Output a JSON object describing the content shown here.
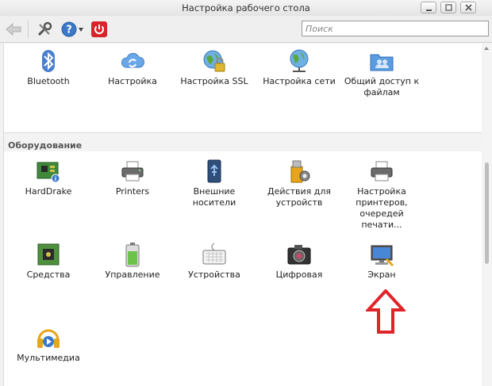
{
  "window": {
    "title": "Настройка рабочего стола"
  },
  "toolbar": {
    "search_placeholder": "Поиск"
  },
  "top_row": [
    {
      "label": "Bluetooth",
      "icon": "bluetooth-icon"
    },
    {
      "label": "Настройка",
      "icon": "cloud-sync-icon"
    },
    {
      "label": "Настройка SSL",
      "icon": "globe-lock-icon"
    },
    {
      "label": "Настройка сети",
      "icon": "globe-network-icon"
    },
    {
      "label": "Общий доступ к файлам",
      "icon": "shared-folder-icon"
    }
  ],
  "hardware": {
    "title": "Оборудование",
    "items": [
      {
        "label": "HardDrake",
        "icon": "circuit-board-icon"
      },
      {
        "label": "Printers",
        "icon": "printer-icon"
      },
      {
        "label": "Внешние носители",
        "icon": "usb-drive-icon"
      },
      {
        "label": "Действия для устройств",
        "icon": "usb-gear-icon"
      },
      {
        "label": "Настройка принтеров, очередей печати...",
        "icon": "printer-queue-icon"
      },
      {
        "label": "Средства",
        "icon": "chip-tools-icon"
      },
      {
        "label": "Управление",
        "icon": "battery-icon"
      },
      {
        "label": "Устройства",
        "icon": "keyboard-icon"
      },
      {
        "label": "Цифровая",
        "icon": "camera-icon"
      },
      {
        "label": "Экран",
        "icon": "monitor-icon"
      },
      {
        "label": "Мультимедиа",
        "icon": "headphones-icon"
      }
    ]
  },
  "colors": {
    "annotation_arrow": "#e0242a",
    "power_button": "#d8232a",
    "help_button": "#3a78c8"
  }
}
